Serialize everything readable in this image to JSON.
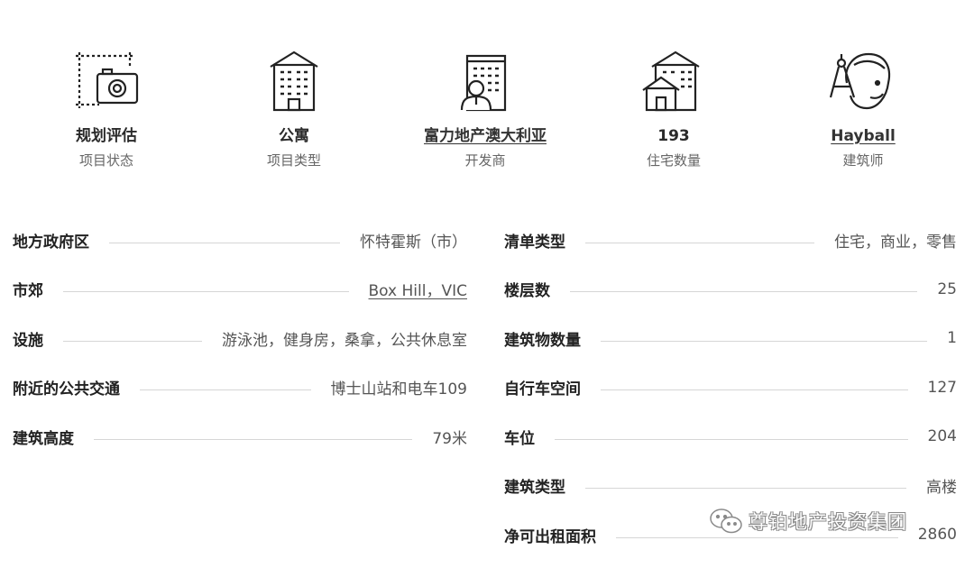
{
  "stats": [
    {
      "icon": "planning-camera-icon",
      "value": "规划评估",
      "label": "项目状态",
      "link": false
    },
    {
      "icon": "apartment-building-icon",
      "value": "公寓",
      "label": "项目类型",
      "link": false
    },
    {
      "icon": "developer-building-icon",
      "value": "富力地产澳大利亚",
      "label": "开发商",
      "link": true
    },
    {
      "icon": "houses-icon",
      "value": "193",
      "label": "住宅数量",
      "link": false
    },
    {
      "icon": "architect-compass-icon",
      "value": "Hayball",
      "label": "建筑师",
      "link": true
    }
  ],
  "left_details": [
    {
      "key": "地方政府区",
      "value": "怀特霍斯（市）",
      "link": false
    },
    {
      "key": "市郊",
      "value": "Box Hill，VIC",
      "link": true
    },
    {
      "key": "设施",
      "value": "游泳池，健身房，桑拿，公共休息室",
      "link": false
    },
    {
      "key": "附近的公共交通",
      "value": "博士山站和电车109",
      "link": false
    },
    {
      "key": "建筑高度",
      "value": "79米",
      "link": false
    }
  ],
  "right_details": [
    {
      "key": "清单类型",
      "value": "住宅，商业，零售",
      "link": false
    },
    {
      "key": "楼层数",
      "value": "25",
      "link": false
    },
    {
      "key": "建筑物数量",
      "value": "1",
      "link": false
    },
    {
      "key": "自行车空间",
      "value": "127",
      "link": false
    },
    {
      "key": "车位",
      "value": "204",
      "link": false
    },
    {
      "key": "建筑类型",
      "value": "高楼",
      "link": false
    },
    {
      "key": "净可出租面积",
      "value": "2860",
      "link": false
    }
  ],
  "watermark": {
    "text": "尊铂地产投资集团",
    "icon": "wechat-icon"
  }
}
